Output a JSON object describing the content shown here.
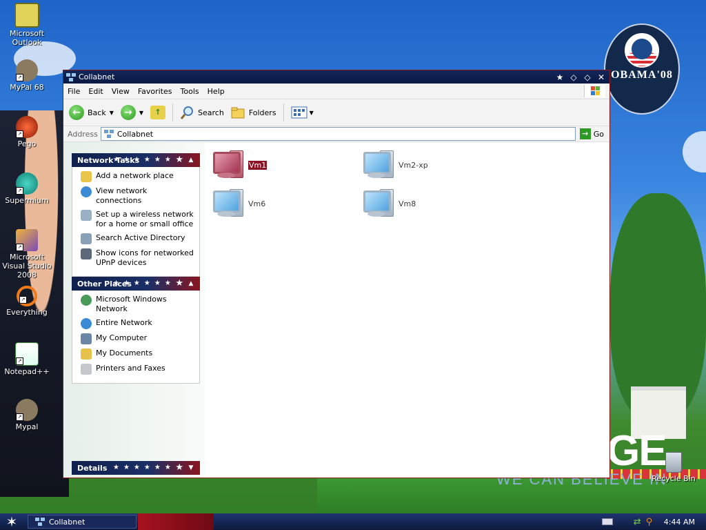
{
  "desktop": {
    "icons": [
      {
        "label": "Microsoft Outlook",
        "icon": "outlook-icon"
      },
      {
        "label": "MyPal 68",
        "icon": "mypal-icon"
      },
      {
        "label": "Pego",
        "icon": "pego-icon"
      },
      {
        "label": "Supermium",
        "icon": "supermium-icon"
      },
      {
        "label": "Microsoft Visual Studio 2008",
        "icon": "visual-studio-icon"
      },
      {
        "label": "Everything",
        "icon": "everything-icon"
      },
      {
        "label": "Notepad++",
        "icon": "notepadpp-icon"
      },
      {
        "label": "Mypal",
        "icon": "mypal-icon"
      }
    ],
    "recycle_bin": "Recycle Bin",
    "wallpaper": {
      "badge_text": "OBAMA'08",
      "slogan_fragment": "GE",
      "tagline_fragment": "WE CAN BELIEVE IN"
    }
  },
  "window": {
    "title": "Collabnet",
    "menu": [
      "File",
      "Edit",
      "View",
      "Favorites",
      "Tools",
      "Help"
    ],
    "toolbar": {
      "back": "Back",
      "search": "Search",
      "folders": "Folders"
    },
    "address": {
      "label": "Address",
      "value": "Collabnet",
      "go": "Go"
    },
    "panels": {
      "network_tasks": {
        "title": "Network Tasks",
        "items": [
          "Add a network place",
          "View network connections",
          "Set up a wireless network for a home or small office",
          "Search Active Directory",
          "Show icons for networked UPnP devices"
        ]
      },
      "other_places": {
        "title": "Other Places",
        "items": [
          "Microsoft Windows Network",
          "Entire Network",
          "My Computer",
          "My Documents",
          "Printers and Faxes"
        ]
      },
      "details": {
        "title": "Details"
      }
    },
    "computers": [
      {
        "name": "Vm1",
        "selected": true
      },
      {
        "name": "Vm2-xp",
        "selected": false
      },
      {
        "name": "Vm6",
        "selected": false
      },
      {
        "name": "Vm8",
        "selected": false
      }
    ]
  },
  "taskbar": {
    "task": "Collabnet",
    "clock": "4:44 AM"
  },
  "colors": {
    "title_bar": "#0a1a44",
    "accent_red": "#8b1222",
    "taskbar": "#0d1a3c"
  }
}
